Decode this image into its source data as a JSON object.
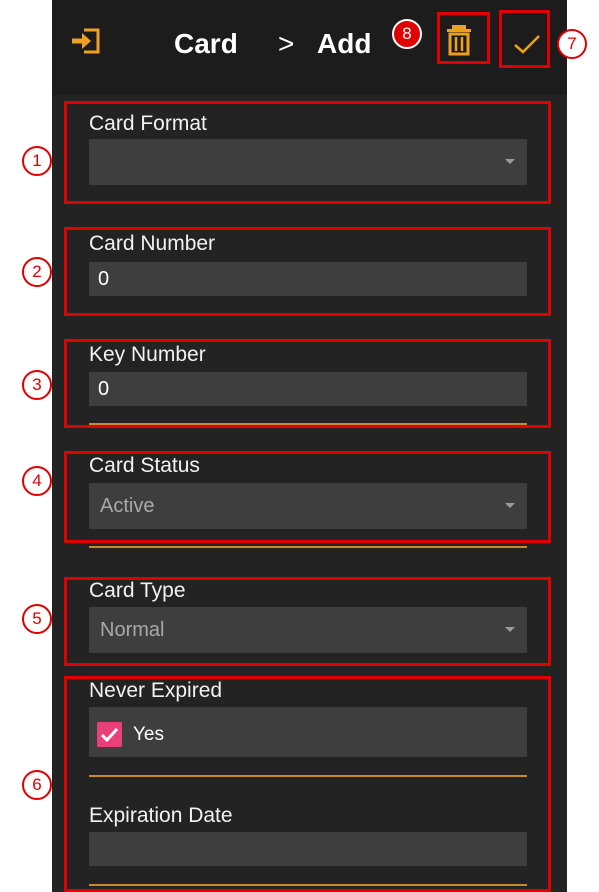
{
  "header": {
    "title": "Card",
    "breadcrumb_separator": ">",
    "subtitle": "Add",
    "back_icon": "exit-arrow-icon",
    "delete_icon": "trash-icon",
    "confirm_icon": "check-icon",
    "accent_color": "#f0a020"
  },
  "form": {
    "card_format": {
      "label": "Card Format",
      "value": ""
    },
    "card_number": {
      "label": "Card Number",
      "value": "0"
    },
    "key_number": {
      "label": "Key Number",
      "value": "0"
    },
    "card_status": {
      "label": "Card Status",
      "value": "Active"
    },
    "card_type": {
      "label": "Card Type",
      "value": "Normal"
    },
    "never_expired": {
      "label": "Never Expired",
      "option_label": "Yes",
      "checked": true
    },
    "expiration_date": {
      "label": "Expiration Date",
      "value": ""
    }
  },
  "annotations": [
    "1",
    "2",
    "3",
    "4",
    "5",
    "6",
    "7",
    "8"
  ],
  "colors": {
    "annotation_red": "#e00000",
    "divider_orange": "#c88a2c",
    "checkbox_pink": "#e8417a"
  }
}
